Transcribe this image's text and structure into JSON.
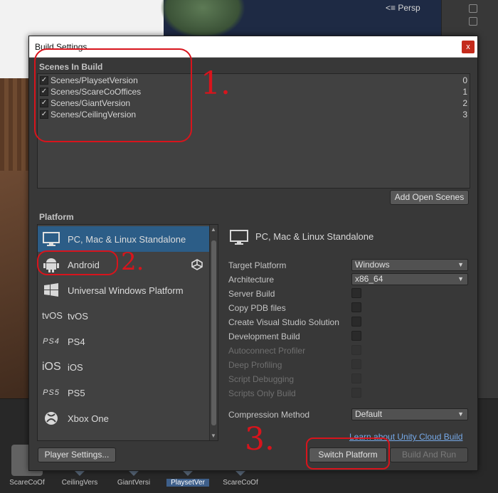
{
  "editor": {
    "view_mode": "Persp",
    "assets": [
      {
        "name": "ScareCoOf",
        "type": "folder",
        "selected": false
      },
      {
        "name": "CeilingVers",
        "type": "unity-scene",
        "selected": false
      },
      {
        "name": "GiantVersi",
        "type": "unity-scene",
        "selected": false
      },
      {
        "name": "PlaysetVer",
        "type": "unity-scene",
        "selected": true
      },
      {
        "name": "ScareCoOf",
        "type": "unity-scene",
        "selected": false
      }
    ]
  },
  "window": {
    "title": "Build Settings",
    "close_glyph": "x"
  },
  "scenes": {
    "label": "Scenes In Build",
    "items": [
      {
        "name": "Scenes/PlaysetVersion",
        "checked": true,
        "index": "0"
      },
      {
        "name": "Scenes/ScareCoOffices",
        "checked": true,
        "index": "1"
      },
      {
        "name": "Scenes/GiantVersion",
        "checked": true,
        "index": "2"
      },
      {
        "name": "Scenes/CeilingVersion",
        "checked": true,
        "index": "3"
      }
    ],
    "add_button": "Add Open Scenes"
  },
  "platform": {
    "label": "Platform",
    "items": [
      {
        "label": "PC, Mac & Linux Standalone",
        "icon": "monitor-icon",
        "selected": true,
        "active": false
      },
      {
        "label": "Android",
        "icon": "android-icon",
        "selected": false,
        "active": true
      },
      {
        "label": "Universal Windows Platform",
        "icon": "windows-icon",
        "selected": false,
        "active": false
      },
      {
        "label": "tvOS",
        "icon": "tvos-icon",
        "selected": false,
        "active": false
      },
      {
        "label": "PS4",
        "icon": "ps4-icon",
        "selected": false,
        "active": false
      },
      {
        "label": "iOS",
        "icon": "ios-icon",
        "selected": false,
        "active": false
      },
      {
        "label": "PS5",
        "icon": "ps5-icon",
        "selected": false,
        "active": false
      },
      {
        "label": "Xbox One",
        "icon": "xbox-icon",
        "selected": false,
        "active": false
      },
      {
        "label": "",
        "icon": "html5-icon",
        "selected": false,
        "active": false
      }
    ],
    "icon_text": {
      "tvos": "tvOS",
      "ps4": "PS4",
      "ios": "iOS",
      "ps5": "PS5"
    }
  },
  "detail": {
    "title": "PC, Mac & Linux Standalone",
    "target_platform": {
      "label": "Target Platform",
      "value": "Windows"
    },
    "architecture": {
      "label": "Architecture",
      "value": "x86_64"
    },
    "options": [
      {
        "label": "Server Build",
        "checked": false,
        "enabled": true
      },
      {
        "label": "Copy PDB files",
        "checked": false,
        "enabled": true
      },
      {
        "label": "Create Visual Studio Solution",
        "checked": false,
        "enabled": true
      },
      {
        "label": "Development Build",
        "checked": false,
        "enabled": true
      },
      {
        "label": "Autoconnect Profiler",
        "checked": false,
        "enabled": false
      },
      {
        "label": "Deep Profiling",
        "checked": false,
        "enabled": false
      },
      {
        "label": "Script Debugging",
        "checked": false,
        "enabled": false
      },
      {
        "label": "Scripts Only Build",
        "checked": false,
        "enabled": false
      }
    ],
    "compression": {
      "label": "Compression Method",
      "value": "Default"
    },
    "cloud_link": "Learn about Unity Cloud Build"
  },
  "footer": {
    "player_settings": "Player Settings...",
    "switch_platform": "Switch Platform",
    "build_and_run": "Build And Run"
  },
  "annotations": {
    "color": "#d8141c",
    "numbers": [
      "1.",
      "2.",
      "3."
    ]
  },
  "colors": {
    "window_bg": "#383838",
    "selection": "#2c5d87",
    "link": "#76a9e8"
  }
}
